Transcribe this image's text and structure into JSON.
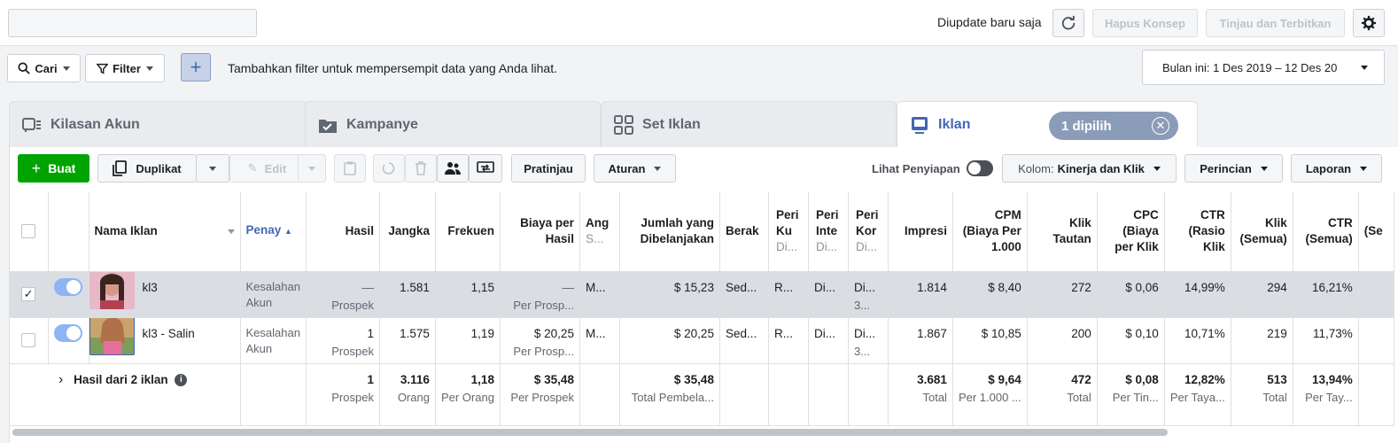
{
  "header": {
    "campaign_select_value": "",
    "update_status": "Diupdate baru saja",
    "discard_label": "Hapus Konsep",
    "publish_label": "Tinjau dan Terbitkan",
    "refresh_icon": "refresh-icon",
    "settings_icon": "gear-icon"
  },
  "filterbar": {
    "search_label": "Cari",
    "filter_label": "Filter",
    "add_label": "+",
    "hint": "Tambahkan filter untuk mempersempit data yang Anda lihat.",
    "date_range": "Bulan ini: 1 Des 2019 – 12 Des 20"
  },
  "tabs": [
    {
      "label": "Kilasan Akun",
      "icon": "account-overview-icon"
    },
    {
      "label": "Kampanye",
      "icon": "folder-icon"
    },
    {
      "label": "Set Iklan",
      "icon": "grid-icon"
    },
    {
      "label": "Iklan",
      "icon": "ad-icon"
    }
  ],
  "selection": {
    "label": "1 dipilih"
  },
  "toolbar": {
    "create_label": "Buat",
    "duplicate_label": "Duplikat",
    "edit_label": "Edit",
    "preview_label": "Pratinjau",
    "rules_label": "Aturan",
    "view_setup_label": "Lihat Penyiapan",
    "columns_prefix": "Kolom:",
    "columns_value": "Kinerja dan Klik",
    "breakdown_label": "Perincian",
    "reports_label": "Laporan"
  },
  "table": {
    "headers": {
      "name": "Nama Iklan",
      "delivery": "Penay",
      "results": "Hasil",
      "reach": "Jangka",
      "frequency": "Frekuen",
      "cost_per_result_1": "Biaya per",
      "cost_per_result_2": "Hasil",
      "budget_1": "Ang",
      "budget_2": "S...",
      "amount_spent_1": "Jumlah yang",
      "amount_spent_2": "Dibelanjakan",
      "ends": "Berak",
      "schedule_1": "Peri",
      "schedule_2": "Ku",
      "schedule_3": "Di...",
      "int_1": "Peri",
      "int_2": "Inte",
      "int_3": "Di...",
      "kon_1": "Peri",
      "kon_2": "Kor",
      "kon_3": "Di...",
      "impressions": "Impresi",
      "cpm_1": "CPM",
      "cpm_2": "(Biaya Per",
      "cpm_3": "1.000",
      "link_clicks_1": "Klik",
      "link_clicks_2": "Tautan",
      "cpc_1": "CPC",
      "cpc_2": "(Biaya",
      "cpc_3": "per Klik",
      "ctr_1": "CTR",
      "ctr_2": "(Rasio",
      "ctr_3": "Klik",
      "clicks_all_1": "Klik",
      "clicks_all_2": "(Semua)",
      "ctr_all_1": "CTR",
      "ctr_all_2": "(Semua)",
      "last": "(Se"
    },
    "rows": [
      {
        "name": "kl3",
        "delivery_1": "Kesalahan",
        "delivery_2": "Akun",
        "results": "—",
        "results_sub": "Prospek",
        "reach": "1.581",
        "frequency": "1,15",
        "cost_per_result": "—",
        "cost_per_result_sub": "Per Prosp...",
        "budget": "M...",
        "amount_spent": "$ 15,23",
        "ends": "Sed...",
        "schedule": "R...",
        "int": "Di...",
        "kon": "Di...",
        "kon_sub": "3...",
        "impressions": "1.814",
        "cpm": "$ 8,40",
        "link_clicks": "272",
        "cpc": "$ 0,06",
        "ctr": "14,99%",
        "clicks_all": "294",
        "ctr_all": "16,21%"
      },
      {
        "name": "kl3 - Salin",
        "delivery_1": "Kesalahan",
        "delivery_2": "Akun",
        "results": "1",
        "results_sub": "Prospek",
        "reach": "1.575",
        "frequency": "1,19",
        "cost_per_result": "$ 20,25",
        "cost_per_result_sub": "Per Prosp...",
        "budget": "M...",
        "amount_spent": "$ 20,25",
        "ends": "Sed...",
        "schedule": "R...",
        "int": "Di...",
        "kon": "Di...",
        "kon_sub": "3...",
        "impressions": "1.867",
        "cpm": "$ 10,85",
        "link_clicks": "200",
        "cpc": "$ 0,10",
        "ctr": "10,71%",
        "clicks_all": "219",
        "ctr_all": "11,73%"
      }
    ],
    "total": {
      "label": "Hasil dari 2 iklan",
      "results": "1",
      "results_sub": "Prospek",
      "reach": "3.116",
      "reach_sub": "Orang",
      "frequency": "1,18",
      "frequency_sub": "Per Orang",
      "cost_per_result": "$ 35,48",
      "cost_per_result_sub": "Per Prospek",
      "amount_spent": "$ 35,48",
      "amount_spent_sub": "Total Pembela...",
      "impressions": "3.681",
      "impressions_sub": "Total",
      "cpm": "$ 9,64",
      "cpm_sub": "Per 1.000 ...",
      "link_clicks": "472",
      "link_clicks_sub": "Total",
      "cpc": "$ 0,08",
      "cpc_sub": "Per Tin...",
      "ctr": "12,82%",
      "ctr_sub": "Per Taya...",
      "clicks_all": "513",
      "clicks_all_sub": "Total",
      "ctr_all": "13,94%",
      "ctr_all_sub": "Per Tay..."
    }
  }
}
